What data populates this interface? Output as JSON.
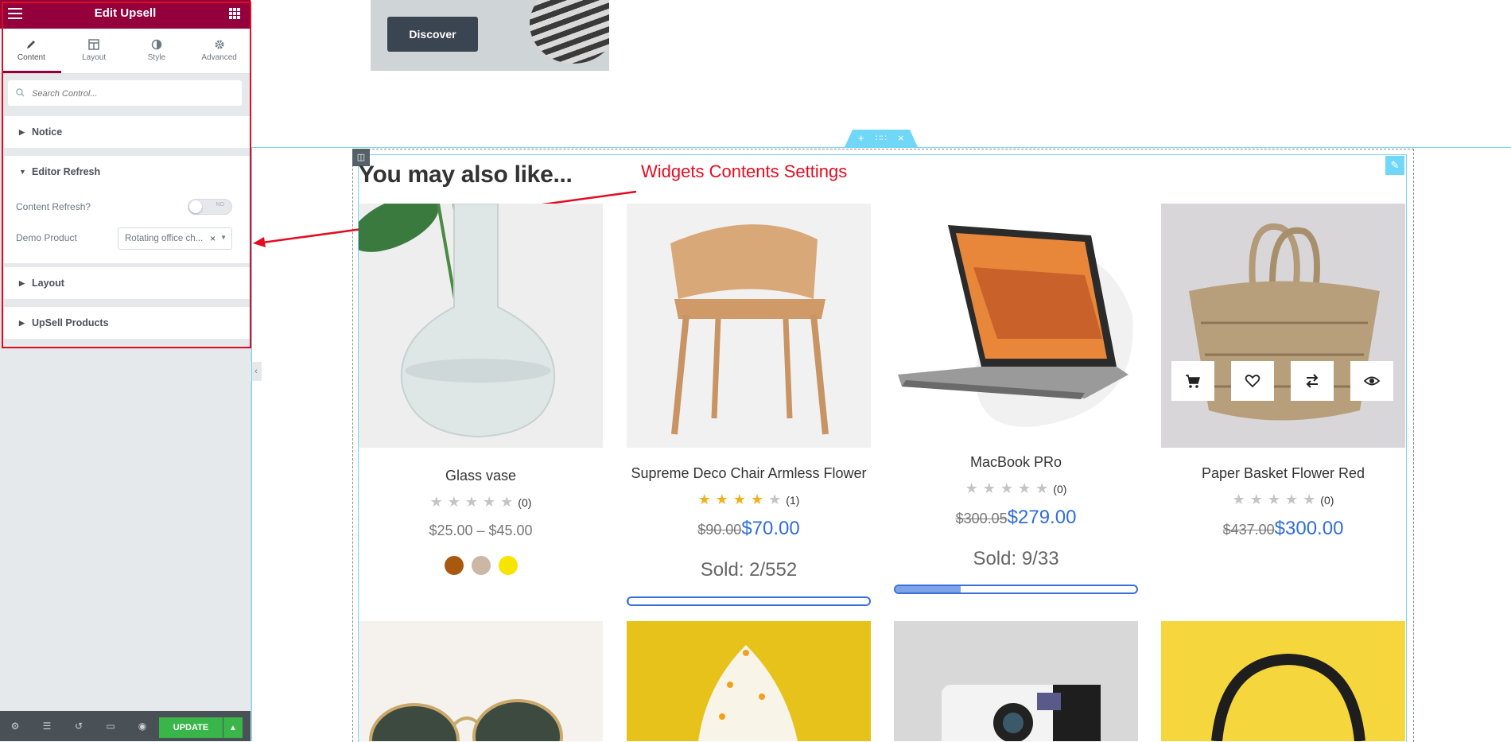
{
  "sidebar": {
    "title": "Edit Upsell",
    "tabs": [
      {
        "label": "Content",
        "active": true,
        "icon": "pencil-icon"
      },
      {
        "label": "Layout",
        "active": false,
        "icon": "layout-icon"
      },
      {
        "label": "Style",
        "active": false,
        "icon": "half-circle-icon"
      },
      {
        "label": "Advanced",
        "active": false,
        "icon": "gear-icon"
      }
    ],
    "search_placeholder": "Search Control...",
    "sections": {
      "notice": "Notice",
      "editor_refresh": "Editor Refresh",
      "layout": "Layout",
      "upsell_products": "UpSell Products"
    },
    "controls": {
      "content_refresh_label": "Content Refresh?",
      "content_refresh_state": "NO",
      "demo_product_label": "Demo Product",
      "demo_product_value": "Rotating office ch..."
    },
    "footer": {
      "update_label": "UPDATE"
    }
  },
  "banner": {
    "discover_label": "Discover"
  },
  "section_title": "You may also like...",
  "annotation": "Widgets Contents Settings",
  "products": [
    {
      "name": "Glass vase",
      "rating": 0,
      "reviews": "(0)",
      "price_range": "$25.00 – $45.00",
      "swatch_colors": [
        "#a8590f",
        "#cbb7a3",
        "#f7e400"
      ]
    },
    {
      "name": "Supreme Deco Chair Armless Flower",
      "rating": 4,
      "reviews": "(1)",
      "old_price": "$90.00",
      "new_price": "$70.00",
      "sold": "Sold: 2/552",
      "sold_fraction": 0.004
    },
    {
      "name": "MacBook PRo",
      "rating": 0,
      "reviews": "(0)",
      "old_price": "$300.05",
      "new_price": "$279.00",
      "sold": "Sold: 9/33",
      "sold_fraction": 0.27
    },
    {
      "name": "Paper Basket Flower Red",
      "rating": 0,
      "reviews": "(0)",
      "old_price": "$437.00",
      "new_price": "$300.00"
    }
  ],
  "colors": {
    "brand": "#93003c",
    "update": "#39b54a",
    "editor_accent": "#71d7f7",
    "annotation": "#e30b20",
    "price_blue": "#2f6ed9",
    "star": "#f2b01e"
  }
}
